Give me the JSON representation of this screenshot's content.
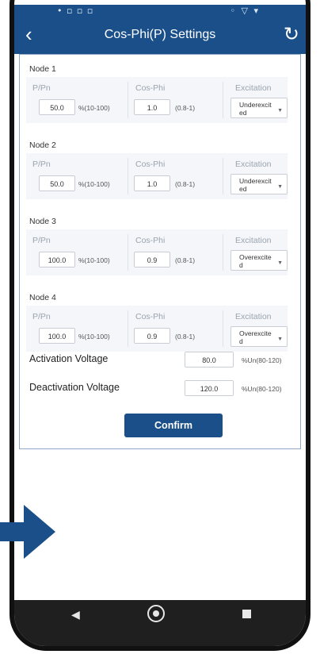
{
  "status": {
    "left": "• ▫ ▫ ▫",
    "right": "◦ ▽ ▾"
  },
  "header": {
    "title": "Cos-Phi(P) Settings",
    "back_icon": "‹",
    "refresh_icon": "↻"
  },
  "columns": {
    "p": "P/Pn",
    "cos": "Cos-Phi",
    "exc": "Excitation"
  },
  "nodes": [
    {
      "label": "Node 1",
      "p": "50.0",
      "p_unit": "%(10-100)",
      "cos": "1.0",
      "cos_unit": "(0.8-1)",
      "exc": "Underexcit ed"
    },
    {
      "label": "Node 2",
      "p": "50.0",
      "p_unit": "%(10-100)",
      "cos": "1.0",
      "cos_unit": "(0.8-1)",
      "exc": "Underexcit ed"
    },
    {
      "label": "Node 3",
      "p": "100.0",
      "p_unit": "%(10-100)",
      "cos": "0.9",
      "cos_unit": "(0.8-1)",
      "exc": "Overexcite d"
    },
    {
      "label": "Node 4",
      "p": "100.0",
      "p_unit": "%(10-100)",
      "cos": "0.9",
      "cos_unit": "(0.8-1)",
      "exc": "Overexcite d"
    }
  ],
  "activation": {
    "label": "Activation Voltage",
    "value": "80.0",
    "unit": "%Un(80-120)"
  },
  "deactivation": {
    "label": "Deactivation Voltage",
    "value": "120.0",
    "unit": "%Un(80-120)"
  },
  "confirm": "Confirm",
  "colors": {
    "accent": "#1a4f8a"
  }
}
